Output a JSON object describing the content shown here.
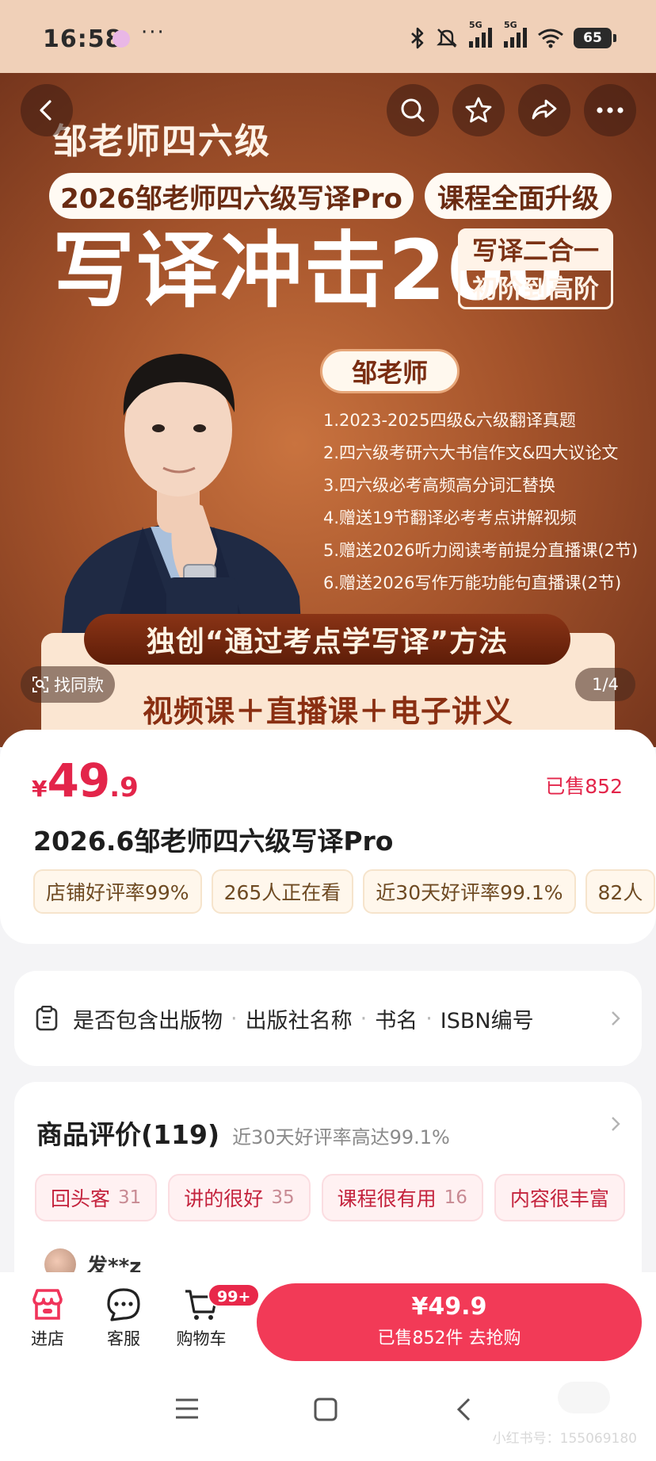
{
  "status_bar": {
    "time": "16:58",
    "dots": "···",
    "signal_1": "5G",
    "signal_2": "5G",
    "battery": "65",
    "icons": [
      "bluetooth-icon",
      "mute-icon",
      "signal-icon",
      "wifi-icon",
      "battery-icon"
    ]
  },
  "nav": {
    "icons": [
      "back-icon",
      "search-icon",
      "star-icon",
      "share-icon",
      "more-icon"
    ]
  },
  "hero": {
    "brand": "邹老师四六级",
    "pill_left": "2026邹老师四六级写译Pro",
    "pill_right": "课程全面升级",
    "headline": "写译冲击200",
    "box_top": "写译二合一",
    "box_bottom": "初阶到高阶",
    "teacher": "邹老师",
    "features": [
      "1.2023-2025四级&六级翻译真题",
      "2.四六级考研六大书信作文&四大议论文",
      "3.四六级必考高频高分词汇替换",
      "4.赠送19节翻译必考考点讲解视频",
      "5.赠送2026听力阅读考前提分直播课(2节)",
      "6.赠送2026写作万能功能句直播课(2节)"
    ],
    "method": "独创“通过考点学写译”方法",
    "method_sub": "视频课＋直播课＋电子讲义",
    "find_same": "找同款",
    "pager": "1/4"
  },
  "product": {
    "currency": "¥",
    "price_int": "49",
    "price_dec": ".9",
    "sold": "已售852",
    "title": "2026.6邹老师四六级写译Pro",
    "tags": [
      "店铺好评率99%",
      "265人正在看",
      "近30天好评率99.1%",
      "82人"
    ]
  },
  "info_row": {
    "items": [
      "是否包含出版物",
      "出版社名称",
      "书名",
      "ISBN编号"
    ],
    "separator": "·"
  },
  "reviews": {
    "title": "商品评价(119)",
    "subtitle": "近30天好评率高达99.1%",
    "tags": [
      {
        "label": "回头客",
        "count": "31"
      },
      {
        "label": "讲的很好",
        "count": "35"
      },
      {
        "label": "课程很有用",
        "count": "16"
      },
      {
        "label": "内容很丰富",
        "count": ""
      }
    ],
    "first_reviewer": "发**z"
  },
  "action_bar": {
    "store": "进店",
    "service": "客服",
    "cart": "购物车",
    "cart_badge": "99+",
    "buy_price": "¥49.9",
    "buy_sub": "已售852件  去抢购"
  },
  "watermark": "小红书号：155069180",
  "colors": {
    "accent": "#f23a57",
    "price_red": "#e3254a",
    "hero_brown": "#a4532b"
  }
}
